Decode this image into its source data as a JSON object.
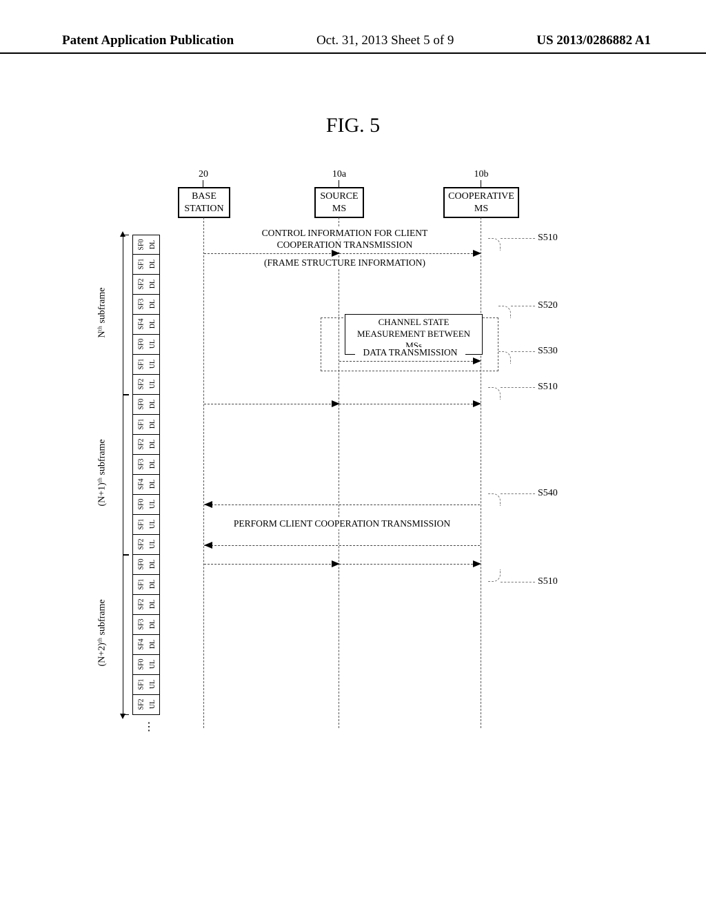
{
  "header": {
    "publication_type": "Patent Application Publication",
    "date_sheet": "Oct. 31, 2013   Sheet 5 of 9",
    "publication_number": "US 2013/0286882 A1"
  },
  "figure_label": "FIG. 5",
  "columns": {
    "base_station": {
      "num": "20",
      "label_line1": "BASE",
      "label_line2": "STATION"
    },
    "source_ms": {
      "num": "10a",
      "label_line1": "SOURCE",
      "label_line2": "MS"
    },
    "coop_ms": {
      "num": "10b",
      "label_line1": "COOPERATIVE",
      "label_line2": "MS"
    }
  },
  "subframes": {
    "group_labels": [
      "Nᵗʰ subframe",
      "(N+1)ᵗʰ subframe",
      "(N+2)ᵗʰ subframe"
    ],
    "group": [
      [
        {
          "dir": "DL",
          "sf": "SF0"
        },
        {
          "dir": "DL",
          "sf": "SF1"
        },
        {
          "dir": "DL",
          "sf": "SF2"
        },
        {
          "dir": "DL",
          "sf": "SF3"
        },
        {
          "dir": "DL",
          "sf": "SF4"
        },
        {
          "dir": "UL",
          "sf": "SF0"
        },
        {
          "dir": "UL",
          "sf": "SF1"
        },
        {
          "dir": "UL",
          "sf": "SF2"
        }
      ],
      [
        {
          "dir": "DL",
          "sf": "SF0"
        },
        {
          "dir": "DL",
          "sf": "SF1"
        },
        {
          "dir": "DL",
          "sf": "SF2"
        },
        {
          "dir": "DL",
          "sf": "SF3"
        },
        {
          "dir": "DL",
          "sf": "SF4"
        },
        {
          "dir": "UL",
          "sf": "SF0"
        },
        {
          "dir": "UL",
          "sf": "SF1"
        },
        {
          "dir": "UL",
          "sf": "SF2"
        }
      ],
      [
        {
          "dir": "DL",
          "sf": "SF0"
        },
        {
          "dir": "DL",
          "sf": "SF1"
        },
        {
          "dir": "DL",
          "sf": "SF2"
        },
        {
          "dir": "DL",
          "sf": "SF3"
        },
        {
          "dir": "DL",
          "sf": "SF4"
        },
        {
          "dir": "UL",
          "sf": "SF0"
        },
        {
          "dir": "UL",
          "sf": "SF1"
        },
        {
          "dir": "UL",
          "sf": "SF2"
        }
      ]
    ]
  },
  "messages": {
    "s510_text_line1": "CONTROL INFORMATION FOR CLIENT",
    "s510_text_line2": "COOPERATION TRANSMISSION",
    "s510_text_line3": "(FRAME STRUCTURE INFORMATION)",
    "s520_box_line1": "CHANNEL STATE",
    "s520_box_line2": "MEASUREMENT BETWEEN MSs",
    "s530_text": "DATA TRANSMISSION",
    "s540_text": "PERFORM CLIENT COOPERATION TRANSMISSION"
  },
  "steps": {
    "s510": "S510",
    "s520": "S520",
    "s530": "S530",
    "s540": "S540"
  }
}
